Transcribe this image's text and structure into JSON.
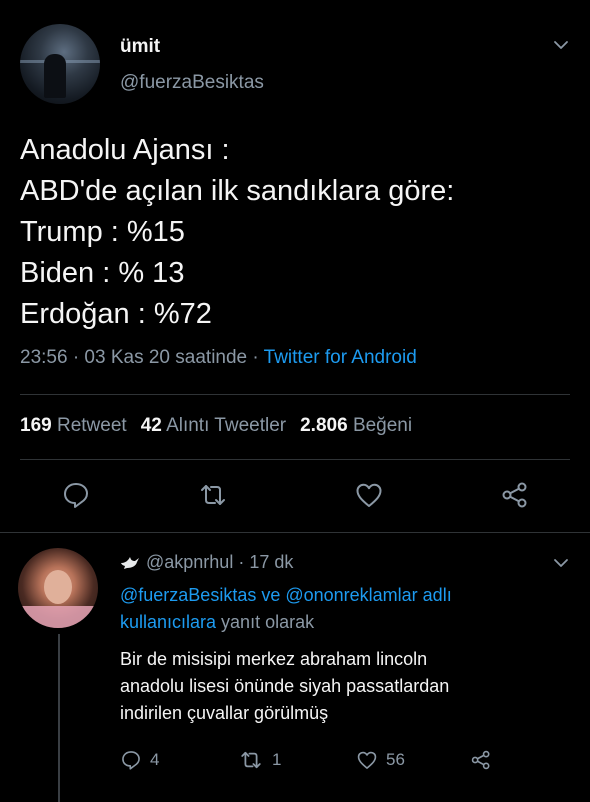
{
  "tweet": {
    "author_name": "ümit",
    "author_handle": "@fuerzaBesiktas",
    "lines": [
      "Anadolu Ajansı :",
      "ABD'de açılan ilk sandıklara göre:",
      "Trump : %15",
      "Biden : % 13",
      "Erdoğan : %72"
    ],
    "timestamp": "23:56 · 03 Kas 20 saatinde",
    "separator": " · ",
    "client": "Twitter for Android",
    "stats": {
      "retweets": "169",
      "retweets_label": "Retweet",
      "quotes": "42",
      "quotes_label": "Alıntı Tweetler",
      "likes": "2.806",
      "likes_label": "Beğeni"
    }
  },
  "reply": {
    "handle": "@akpnrhul",
    "time": " · 17 dk",
    "context_user1": "@fuerzaBesiktas",
    "context_and": " ve ",
    "context_user2": "@ononreklamlar adlı kullanıcılara",
    "context_suffix": " yanıt olarak",
    "lines": [
      "Bir de misisipi merkez abraham lincoln",
      "anadolu lisesi önünde siyah passatlardan",
      "indirilen çuvallar görülmüş"
    ],
    "reply_count": "4",
    "retweet_count": "1",
    "like_count": "56"
  },
  "colors": {
    "background": "#000000",
    "text_primary": "#f5f5f5",
    "text_secondary": "#8b98a5",
    "link": "#1d9bf0"
  },
  "icons": [
    "chevron-down-icon",
    "reply-icon",
    "retweet-icon",
    "like-icon",
    "share-icon",
    "dove-icon"
  ]
}
